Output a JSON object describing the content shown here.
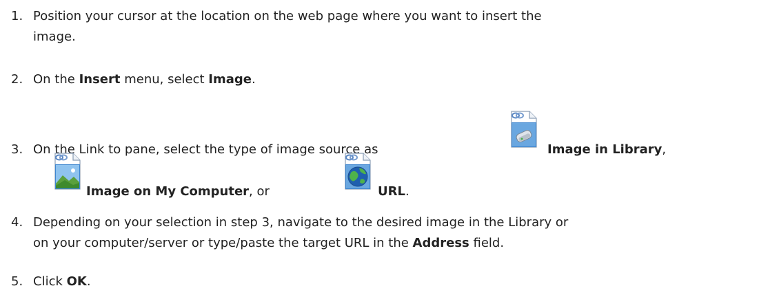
{
  "steps": [
    {
      "number": "1.",
      "text_line1": "Position your cursor at the location on the web page where you want to insert the",
      "text_line2": "image."
    },
    {
      "number": "2.",
      "text_a": "On the ",
      "bold_a": "Insert",
      "text_b": " menu, select ",
      "bold_b": "Image",
      "text_c": "."
    },
    {
      "number": "3.",
      "text_a": "On the Link to pane, select the type of image source as ",
      "opt1_label": "Image in Library",
      "sep1": ",",
      "opt2_label": "Image on My Computer",
      "sep2": ", or ",
      "opt3_label": "URL",
      "end": "."
    },
    {
      "number": "4.",
      "text_line1": "Depending on your selection in step 3, navigate to the desired image in the Library or",
      "text_line2_a": "on your computer/server or type/paste the target URL in the ",
      "bold": "Address",
      "text_line2_b": " field."
    },
    {
      "number": "5.",
      "text_a": "Click ",
      "bold": "OK",
      "text_b": "."
    }
  ],
  "icons": {
    "library": "library-image-file-icon",
    "computer": "computer-image-file-icon",
    "url": "url-globe-file-icon"
  }
}
